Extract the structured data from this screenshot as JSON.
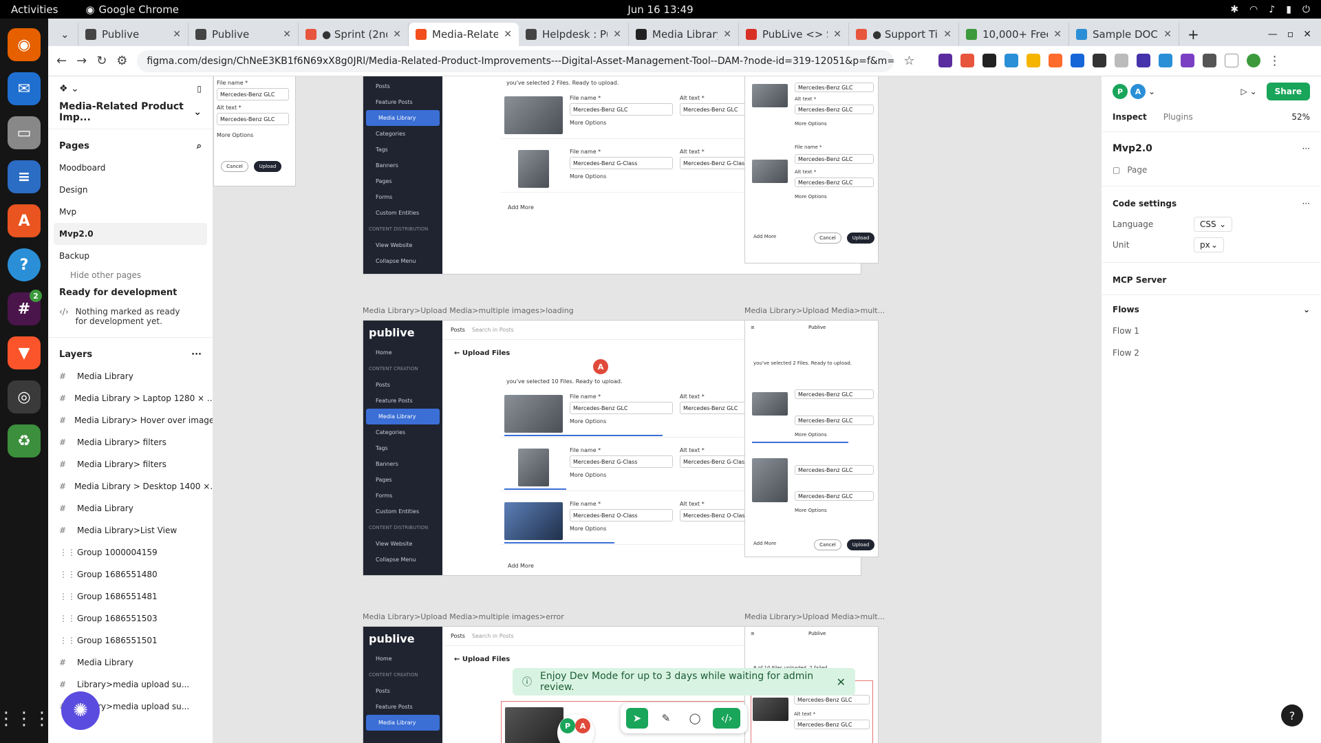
{
  "os": {
    "activities": "Activities",
    "app_name": "Google Chrome",
    "clock": "Jun 16  13:49"
  },
  "dock": {
    "apps": [
      "Firefox",
      "Thunderbird",
      "Files",
      "Writer",
      "App Center",
      "Help",
      "Slack",
      "Brave",
      "Chrome",
      "Trash"
    ],
    "slack_badge": "2"
  },
  "browser": {
    "tabs": [
      {
        "label": "Publive",
        "color": "#444"
      },
      {
        "label": "Publive",
        "color": "#444"
      },
      {
        "label": "● Sprint (2nd",
        "color": "#e8553d"
      },
      {
        "label": "Media-Relate",
        "color": "#f24e1e"
      },
      {
        "label": "Helpdesk : Pu",
        "color": "#444"
      },
      {
        "label": "Media Library",
        "color": "#222"
      },
      {
        "label": "PubLive <> Sa",
        "color": "#d93025"
      },
      {
        "label": "● Support Ti",
        "color": "#e8553d"
      },
      {
        "label": "10,000+ Free",
        "color": "#3c9a3c"
      },
      {
        "label": "Sample DOC",
        "color": "#2a8fd6"
      }
    ],
    "active_tab": 3,
    "new_tab": "+",
    "url": "figma.com/design/ChNeE3KB1f6N69xX8g0JRl/Media-Related-Product-Improvements---Digital-Asset-Management-Tool--DAM-?node-id=319-12051&p=f&m=dev"
  },
  "left_panel": {
    "project_title": "Media-Related Product Imp...",
    "pages_heading": "Pages",
    "pages": [
      "Moodboard",
      "Design",
      "Mvp",
      "Mvp2.0",
      "Backup"
    ],
    "selected_page": "Mvp2.0",
    "hide_other_pages": "Hide other pages",
    "ready_heading": "Ready for development",
    "ready_empty": "Nothing marked as ready for development yet.",
    "layers_heading": "Layers",
    "layers": [
      {
        "icon": "#",
        "label": "Media Library"
      },
      {
        "icon": "#",
        "label": "Media Library > Laptop 1280 × ..."
      },
      {
        "icon": "#",
        "label": "Media Library> Hover over image"
      },
      {
        "icon": "#",
        "label": "Media Library> filters"
      },
      {
        "icon": "#",
        "label": "Media Library> filters"
      },
      {
        "icon": "#",
        "label": "Media Library > Desktop 1400 ×..."
      },
      {
        "icon": "#",
        "label": "Media Library"
      },
      {
        "icon": "#",
        "label": "Media Library>List View"
      },
      {
        "icon": "⋮⋮",
        "label": "Group 1000004159"
      },
      {
        "icon": "⋮⋮",
        "label": "Group 1686551480"
      },
      {
        "icon": "⋮⋮",
        "label": "Group 1686551481"
      },
      {
        "icon": "⋮⋮",
        "label": "Group 1686551503"
      },
      {
        "icon": "⋮⋮",
        "label": "Group 1686551501"
      },
      {
        "icon": "#",
        "label": "Media Library"
      },
      {
        "icon": "#",
        "label": "Library>media upload su..."
      },
      {
        "icon": "#",
        "label": "Library>media upload su..."
      }
    ]
  },
  "canvas": {
    "frame_loading_label": "Media Library>Upload Media>multiple images>loading",
    "frame_error_label": "Media Library>Upload Media>multiple images>error",
    "frame_mobile_label": "Media Library>Upload Media>mult...",
    "app": {
      "logo": "publive",
      "home": "Home",
      "content_creation": "CONTENT CREATION",
      "nav": [
        "Posts",
        "Feature Posts",
        "Media Library",
        "Categories",
        "Tags",
        "Banners",
        "Pages",
        "Forms",
        "Custom Entities"
      ],
      "content_distribution": "CONTENT DISTRIBUTION",
      "view_website": "View Website",
      "collapse_menu": "Collapse Menu",
      "search_scope": "Posts",
      "search_placeholder": "Search in Posts",
      "workspace": "Publive",
      "upload_title": "Upload Files",
      "cancel": "Cancel",
      "upload": "Upload",
      "selected_10": "you've selected 10 Files. Ready to upload.",
      "selected_2": "you've selected 2 Files. Ready to upload.",
      "error_status": "8 of 10 Files uploaded. 2 failed.",
      "file_name_label": "File name *",
      "alt_text_label": "Alt text *",
      "more_options": "More Options",
      "add_more": "Add More",
      "val_glc": "Mercedes-Benz GLC",
      "val_gclass": "Mercedes-Benz G-Class",
      "val_gclass_o": "Mercedes-Benz O-Class"
    },
    "cursor_avatar": "A"
  },
  "toast": {
    "message": "Enjoy Dev Mode for up to 3 days while waiting for admin review.",
    "close": "✕"
  },
  "toolbar": {
    "tools": [
      "move-tool",
      "pen-tool",
      "comment-tool",
      "dev-mode-toggle"
    ]
  },
  "right_panel": {
    "avatars": [
      "P",
      "A"
    ],
    "share": "Share",
    "tab_inspect": "Inspect",
    "tab_plugins": "Plugins",
    "zoom": "52%",
    "frame_name": "Mvp2.0",
    "frame_type": "Page",
    "code_settings": "Code settings",
    "language_label": "Language",
    "language_value": "CSS",
    "unit_label": "Unit",
    "unit_value": "px",
    "mcp_server": "MCP Server",
    "flows": "Flows",
    "flow_items": [
      "Flow 1",
      "Flow 2"
    ]
  },
  "colors": {
    "accent_green": "#19a55a",
    "app_sidebar": "#1f2430",
    "app_selected": "#3b6fd6"
  }
}
